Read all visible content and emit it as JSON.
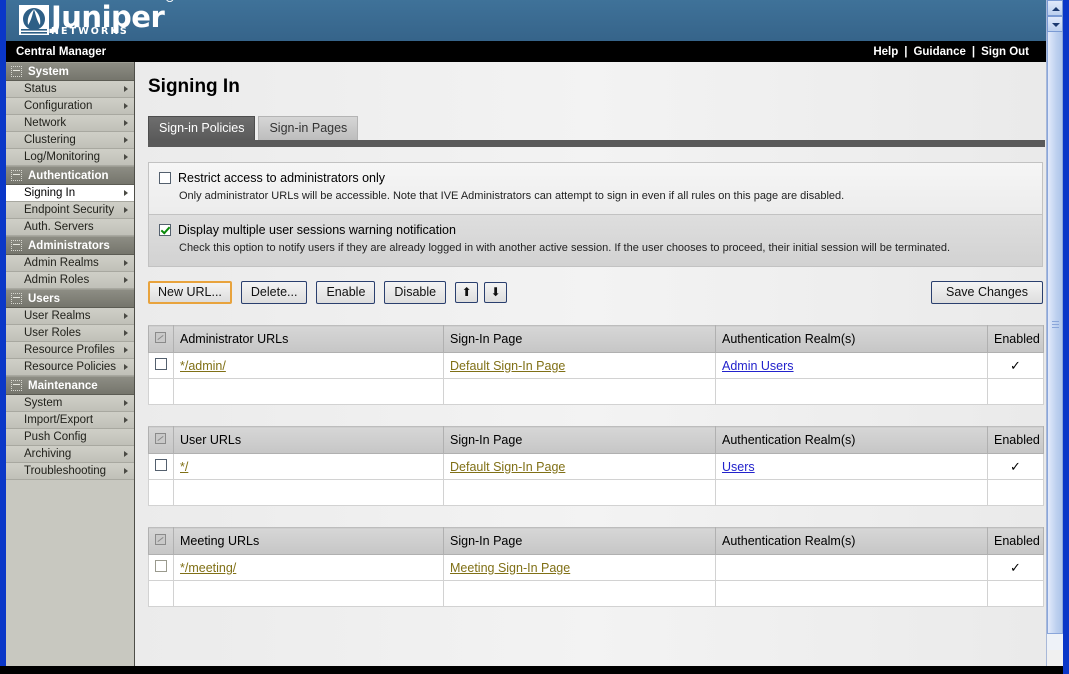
{
  "brand": {
    "name": "Juniper",
    "registered": "®",
    "tagline": "NETWORKS",
    "logo_icon": "juniper-logo-icon"
  },
  "utility_bar": {
    "app_name": "Central Manager",
    "links": [
      {
        "label": "Help"
      },
      {
        "label": "Guidance"
      },
      {
        "label": "Sign Out"
      }
    ],
    "separator": "|"
  },
  "sidebar": {
    "groups": [
      {
        "label": "System",
        "items": [
          {
            "label": "Status",
            "has_arrow": true,
            "active": false
          },
          {
            "label": "Configuration",
            "has_arrow": true,
            "active": false
          },
          {
            "label": "Network",
            "has_arrow": true,
            "active": false
          },
          {
            "label": "Clustering",
            "has_arrow": true,
            "active": false
          },
          {
            "label": "Log/Monitoring",
            "has_arrow": true,
            "active": false
          }
        ]
      },
      {
        "label": "Authentication",
        "items": [
          {
            "label": "Signing In",
            "has_arrow": true,
            "active": true
          },
          {
            "label": "Endpoint Security",
            "has_arrow": true,
            "active": false
          },
          {
            "label": "Auth. Servers",
            "has_arrow": false,
            "active": false
          }
        ]
      },
      {
        "label": "Administrators",
        "items": [
          {
            "label": "Admin Realms",
            "has_arrow": true,
            "active": false
          },
          {
            "label": "Admin Roles",
            "has_arrow": true,
            "active": false
          }
        ]
      },
      {
        "label": "Users",
        "items": [
          {
            "label": "User Realms",
            "has_arrow": true,
            "active": false
          },
          {
            "label": "User Roles",
            "has_arrow": true,
            "active": false
          },
          {
            "label": "Resource Profiles",
            "has_arrow": true,
            "active": false
          },
          {
            "label": "Resource Policies",
            "has_arrow": true,
            "active": false
          }
        ]
      },
      {
        "label": "Maintenance",
        "items": [
          {
            "label": "System",
            "has_arrow": true,
            "active": false
          },
          {
            "label": "Import/Export",
            "has_arrow": true,
            "active": false
          },
          {
            "label": "Push Config",
            "has_arrow": false,
            "active": false
          },
          {
            "label": "Archiving",
            "has_arrow": true,
            "active": false
          },
          {
            "label": "Troubleshooting",
            "has_arrow": true,
            "active": false
          }
        ]
      }
    ]
  },
  "main": {
    "page_title": "Signing In",
    "tabs": [
      {
        "label": "Sign-in Policies",
        "active": true
      },
      {
        "label": "Sign-in Pages",
        "active": false
      }
    ],
    "options": [
      {
        "label": "Restrict access to administrators only",
        "checked": false,
        "description": "Only administrator URLs will be accessible. Note that IVE Administrators can attempt to sign in even if all rules on this page are disabled."
      },
      {
        "label": "Display multiple user sessions warning notification",
        "checked": true,
        "description": "Check this option to notify users if they are already logged in with another active session. If the user chooses to proceed, their initial session will be terminated."
      }
    ],
    "toolbar": {
      "new_url_label": "New URL...",
      "delete_label": "Delete...",
      "enable_label": "Enable",
      "disable_label": "Disable",
      "move_up_icon": "arrow-up-icon",
      "move_down_icon": "arrow-down-icon",
      "move_up_glyph": "⬆",
      "move_down_glyph": "⬇",
      "save_label": "Save Changes"
    },
    "tables": [
      {
        "id": "administrator-urls",
        "headers": {
          "select": "",
          "url": "Administrator URLs",
          "page": "Sign-In Page",
          "realm": "Authentication Realm(s)",
          "enabled": "Enabled"
        },
        "rows": [
          {
            "selected": false,
            "url": "*/admin/",
            "page": "Default Sign-In Page",
            "realm": "Admin Users",
            "enabled": true,
            "enabled_glyph": "✓"
          }
        ]
      },
      {
        "id": "user-urls",
        "headers": {
          "select": "",
          "url": "User URLs",
          "page": "Sign-In Page",
          "realm": "Authentication Realm(s)",
          "enabled": "Enabled"
        },
        "rows": [
          {
            "selected": false,
            "url": "*/",
            "page": "Default Sign-In Page",
            "realm": "Users",
            "enabled": true,
            "enabled_glyph": "✓"
          }
        ]
      },
      {
        "id": "meeting-urls",
        "headers": {
          "select": "",
          "url": "Meeting URLs",
          "page": "Sign-In Page",
          "realm": "Authentication Realm(s)",
          "enabled": "Enabled"
        },
        "rows": [
          {
            "selected": false,
            "url": "*/meeting/",
            "page": "Meeting Sign-In Page",
            "realm": "",
            "enabled": true,
            "enabled_glyph": "✓"
          }
        ]
      }
    ]
  },
  "scrollbar": {
    "up_icon": "scroll-up-icon",
    "down_icon": "scroll-down-icon"
  },
  "colors": {
    "brand_blue": "#3c6d96",
    "accent_focus": "#e8a33d",
    "url_link": "#807016",
    "realm_link": "#2222cc",
    "check_green": "#0a8a0a",
    "frame_blue": "#0a37c8"
  }
}
